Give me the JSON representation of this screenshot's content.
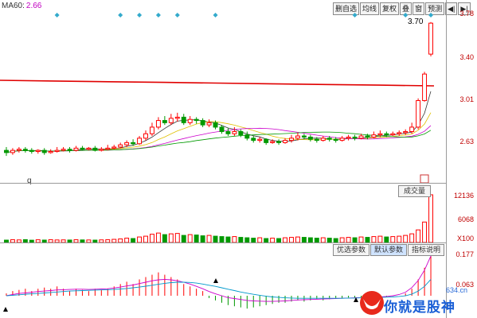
{
  "ma_indicator": {
    "label": "MA60:",
    "value": "2.66"
  },
  "toolbar": {
    "buttons": [
      "删自选",
      "均线",
      "复权",
      "叠",
      "窗",
      "预测",
      "◀|",
      "▶|"
    ]
  },
  "price_axis": [
    "3.78",
    "3.40",
    "3.01",
    "2.63"
  ],
  "last_price_label": "3.70",
  "volume": {
    "button_label": "成交量",
    "axis_labels": [
      "12136",
      "6068",
      "X100"
    ]
  },
  "indicator": {
    "tabs": [
      "优选参数",
      "默认参数",
      "指标说明"
    ],
    "active_tab": 1,
    "axis_labels": [
      "0.177",
      "0.063"
    ]
  },
  "misc": {
    "q_mark": "q"
  },
  "watermark": {
    "text": "你就是股神",
    "url": "634.cn"
  },
  "colors": {
    "up": "#ff0000",
    "down": "#009900",
    "ma60": "#e00000",
    "accent": "#33aacc"
  },
  "chart_data": {
    "type": "candlestick",
    "y_axis": {
      "min": 2.45,
      "max": 3.85,
      "ticks": [
        3.78,
        3.4,
        3.01,
        2.63
      ]
    },
    "candles": [
      {
        "o": 2.55,
        "c": 2.53,
        "h": 2.58,
        "l": 2.5
      },
      {
        "o": 2.53,
        "c": 2.55,
        "h": 2.57,
        "l": 2.51
      },
      {
        "o": 2.55,
        "c": 2.56,
        "h": 2.58,
        "l": 2.53
      },
      {
        "o": 2.56,
        "c": 2.55,
        "h": 2.58,
        "l": 2.53
      },
      {
        "o": 2.55,
        "c": 2.54,
        "h": 2.57,
        "l": 2.52
      },
      {
        "o": 2.54,
        "c": 2.55,
        "h": 2.56,
        "l": 2.52
      },
      {
        "o": 2.55,
        "c": 2.53,
        "h": 2.57,
        "l": 2.51
      },
      {
        "o": 2.53,
        "c": 2.54,
        "h": 2.56,
        "l": 2.52
      },
      {
        "o": 2.54,
        "c": 2.55,
        "h": 2.58,
        "l": 2.53
      },
      {
        "o": 2.55,
        "c": 2.56,
        "h": 2.58,
        "l": 2.54
      },
      {
        "o": 2.56,
        "c": 2.55,
        "h": 2.58,
        "l": 2.53
      },
      {
        "o": 2.55,
        "c": 2.57,
        "h": 2.59,
        "l": 2.54
      },
      {
        "o": 2.57,
        "c": 2.56,
        "h": 2.59,
        "l": 2.55
      },
      {
        "o": 2.56,
        "c": 2.57,
        "h": 2.58,
        "l": 2.55
      },
      {
        "o": 2.57,
        "c": 2.55,
        "h": 2.59,
        "l": 2.54
      },
      {
        "o": 2.55,
        "c": 2.56,
        "h": 2.58,
        "l": 2.54
      },
      {
        "o": 2.56,
        "c": 2.57,
        "h": 2.6,
        "l": 2.55
      },
      {
        "o": 2.57,
        "c": 2.58,
        "h": 2.6,
        "l": 2.56
      },
      {
        "o": 2.58,
        "c": 2.6,
        "h": 2.62,
        "l": 2.57
      },
      {
        "o": 2.6,
        "c": 2.62,
        "h": 2.64,
        "l": 2.58
      },
      {
        "o": 2.62,
        "c": 2.61,
        "h": 2.65,
        "l": 2.59
      },
      {
        "o": 2.61,
        "c": 2.66,
        "h": 2.68,
        "l": 2.6
      },
      {
        "o": 2.66,
        "c": 2.7,
        "h": 2.73,
        "l": 2.64
      },
      {
        "o": 2.7,
        "c": 2.76,
        "h": 2.8,
        "l": 2.68
      },
      {
        "o": 2.76,
        "c": 2.82,
        "h": 2.85,
        "l": 2.74
      },
      {
        "o": 2.82,
        "c": 2.8,
        "h": 2.86,
        "l": 2.78
      },
      {
        "o": 2.8,
        "c": 2.84,
        "h": 2.88,
        "l": 2.78
      },
      {
        "o": 2.84,
        "c": 2.85,
        "h": 2.89,
        "l": 2.81
      },
      {
        "o": 2.85,
        "c": 2.8,
        "h": 2.88,
        "l": 2.78
      },
      {
        "o": 2.8,
        "c": 2.83,
        "h": 2.86,
        "l": 2.78
      },
      {
        "o": 2.83,
        "c": 2.82,
        "h": 2.85,
        "l": 2.79
      },
      {
        "o": 2.82,
        "c": 2.78,
        "h": 2.84,
        "l": 2.76
      },
      {
        "o": 2.78,
        "c": 2.8,
        "h": 2.83,
        "l": 2.76
      },
      {
        "o": 2.8,
        "c": 2.76,
        "h": 2.82,
        "l": 2.74
      },
      {
        "o": 2.76,
        "c": 2.72,
        "h": 2.78,
        "l": 2.7
      },
      {
        "o": 2.72,
        "c": 2.7,
        "h": 2.75,
        "l": 2.68
      },
      {
        "o": 2.7,
        "c": 2.72,
        "h": 2.76,
        "l": 2.68
      },
      {
        "o": 2.72,
        "c": 2.69,
        "h": 2.74,
        "l": 2.67
      },
      {
        "o": 2.69,
        "c": 2.66,
        "h": 2.72,
        "l": 2.64
      },
      {
        "o": 2.66,
        "c": 2.64,
        "h": 2.68,
        "l": 2.62
      },
      {
        "o": 2.64,
        "c": 2.65,
        "h": 2.67,
        "l": 2.62
      },
      {
        "o": 2.65,
        "c": 2.62,
        "h": 2.66,
        "l": 2.6
      },
      {
        "o": 2.62,
        "c": 2.63,
        "h": 2.65,
        "l": 2.61
      },
      {
        "o": 2.63,
        "c": 2.62,
        "h": 2.65,
        "l": 2.6
      },
      {
        "o": 2.62,
        "c": 2.64,
        "h": 2.66,
        "l": 2.61
      },
      {
        "o": 2.64,
        "c": 2.66,
        "h": 2.69,
        "l": 2.62
      },
      {
        "o": 2.66,
        "c": 2.68,
        "h": 2.71,
        "l": 2.64
      },
      {
        "o": 2.68,
        "c": 2.67,
        "h": 2.7,
        "l": 2.65
      },
      {
        "o": 2.67,
        "c": 2.65,
        "h": 2.69,
        "l": 2.63
      },
      {
        "o": 2.65,
        "c": 2.64,
        "h": 2.67,
        "l": 2.62
      },
      {
        "o": 2.64,
        "c": 2.66,
        "h": 2.68,
        "l": 2.63
      },
      {
        "o": 2.66,
        "c": 2.65,
        "h": 2.68,
        "l": 2.63
      },
      {
        "o": 2.65,
        "c": 2.64,
        "h": 2.67,
        "l": 2.62
      },
      {
        "o": 2.64,
        "c": 2.66,
        "h": 2.68,
        "l": 2.63
      },
      {
        "o": 2.66,
        "c": 2.67,
        "h": 2.69,
        "l": 2.64
      },
      {
        "o": 2.67,
        "c": 2.66,
        "h": 2.69,
        "l": 2.64
      },
      {
        "o": 2.66,
        "c": 2.68,
        "h": 2.7,
        "l": 2.65
      },
      {
        "o": 2.68,
        "c": 2.67,
        "h": 2.7,
        "l": 2.65
      },
      {
        "o": 2.67,
        "c": 2.69,
        "h": 2.72,
        "l": 2.66
      },
      {
        "o": 2.69,
        "c": 2.7,
        "h": 2.73,
        "l": 2.67
      },
      {
        "o": 2.7,
        "c": 2.69,
        "h": 2.72,
        "l": 2.67
      },
      {
        "o": 2.69,
        "c": 2.7,
        "h": 2.72,
        "l": 2.68
      },
      {
        "o": 2.7,
        "c": 2.71,
        "h": 2.73,
        "l": 2.68
      },
      {
        "o": 2.71,
        "c": 2.72,
        "h": 2.74,
        "l": 2.69
      },
      {
        "o": 2.72,
        "c": 2.76,
        "h": 2.8,
        "l": 2.7
      },
      {
        "o": 2.76,
        "c": 3.0,
        "h": 3.02,
        "l": 2.74
      },
      {
        "o": 3.0,
        "c": 3.24,
        "h": 3.26,
        "l": 2.99
      },
      {
        "o": 3.42,
        "c": 3.7,
        "h": 3.71,
        "l": 3.4
      }
    ],
    "ma60": [
      3.3,
      3.29,
      3.28,
      3.27,
      3.26,
      3.25,
      3.24,
      3.23,
      3.22
    ],
    "volume": [
      600,
      700,
      650,
      720,
      580,
      690,
      610,
      700,
      640,
      660,
      620,
      700,
      650,
      640,
      600,
      660,
      700,
      800,
      900,
      1100,
      1000,
      1400,
      1600,
      2100,
      2400,
      2000,
      2200,
      2300,
      1800,
      2000,
      1900,
      1700,
      1800,
      1600,
      1500,
      1400,
      1500,
      1300,
      1200,
      1100,
      1200,
      1000,
      1100,
      1000,
      1200,
      1300,
      1400,
      1300,
      1200,
      1100,
      1200,
      1100,
      1000,
      1200,
      1300,
      1200,
      1400,
      1300,
      1500,
      1600,
      1400,
      1500,
      1600,
      1800,
      2200,
      3200,
      5200,
      12136
    ],
    "indicator": {
      "hist": [
        0.01,
        0.02,
        0.025,
        0.03,
        0.02,
        0.03,
        0.035,
        0.03,
        0.04,
        0.03,
        0.02,
        0.03,
        0.025,
        0.02,
        0.03,
        0.025,
        0.03,
        0.04,
        0.05,
        0.06,
        0.05,
        0.07,
        0.08,
        0.09,
        0.1,
        0.09,
        0.08,
        0.07,
        0.05,
        0.04,
        0.03,
        0.02,
        -0.01,
        -0.02,
        -0.03,
        -0.04,
        -0.045,
        -0.05,
        -0.055,
        -0.05,
        -0.045,
        -0.04,
        -0.035,
        -0.03,
        -0.03,
        -0.025,
        -0.02,
        -0.025,
        -0.02,
        -0.015,
        -0.02,
        -0.015,
        -0.01,
        -0.012,
        -0.008,
        -0.01,
        -0.006,
        -0.005,
        -0.004,
        -0.005,
        -0.003,
        -0.002,
        0.0,
        0.01,
        0.03,
        0.07,
        0.12,
        0.18
      ],
      "dif": [
        0.0,
        0.005,
        0.01,
        0.012,
        0.015,
        0.018,
        0.02,
        0.022,
        0.025,
        0.026,
        0.027,
        0.028,
        0.028,
        0.027,
        0.028,
        0.029,
        0.03,
        0.033,
        0.037,
        0.042,
        0.046,
        0.052,
        0.058,
        0.064,
        0.068,
        0.07,
        0.068,
        0.064,
        0.058,
        0.05,
        0.04,
        0.03,
        0.018,
        0.008,
        0.0,
        -0.008,
        -0.012,
        -0.016,
        -0.02,
        -0.022,
        -0.023,
        -0.024,
        -0.024,
        -0.023,
        -0.022,
        -0.02,
        -0.018,
        -0.017,
        -0.016,
        -0.015,
        -0.014,
        -0.013,
        -0.012,
        -0.011,
        -0.01,
        -0.009,
        -0.008,
        -0.007,
        -0.006,
        -0.005,
        -0.003,
        0.0,
        0.005,
        0.015,
        0.035,
        0.065,
        0.11,
        0.17
      ],
      "dea": [
        0.0,
        0.002,
        0.004,
        0.006,
        0.008,
        0.01,
        0.012,
        0.014,
        0.016,
        0.018,
        0.02,
        0.021,
        0.022,
        0.023,
        0.024,
        0.025,
        0.026,
        0.027,
        0.029,
        0.031,
        0.034,
        0.037,
        0.041,
        0.045,
        0.049,
        0.053,
        0.056,
        0.058,
        0.058,
        0.057,
        0.054,
        0.05,
        0.045,
        0.04,
        0.034,
        0.028,
        0.022,
        0.016,
        0.011,
        0.006,
        0.002,
        -0.002,
        -0.005,
        -0.007,
        -0.009,
        -0.01,
        -0.011,
        -0.011,
        -0.011,
        -0.011,
        -0.011,
        -0.011,
        -0.011,
        -0.011,
        -0.01,
        -0.01,
        -0.009,
        -0.009,
        -0.008,
        -0.007,
        -0.006,
        -0.005,
        -0.003,
        0.0,
        0.007,
        0.02,
        0.04,
        0.07
      ]
    }
  }
}
